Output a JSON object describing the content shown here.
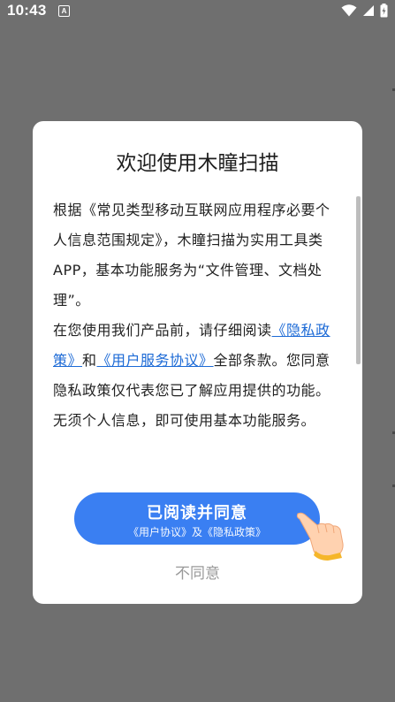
{
  "status_bar": {
    "time": "10:43",
    "notification_icon": "A"
  },
  "dialog": {
    "title": "欢迎使用木瞳扫描",
    "body": {
      "p1": "根据《常见类型移动互联网应用程序必要个人信息范围规定》，木瞳扫描为实用工具类APP，基本功能服务为“文件管理、文档处理”。",
      "p2_prefix": "在您使用我们产品前，请仔细阅读",
      "privacy_link": "《隐私政策》",
      "and": "和",
      "terms_link": "《用户服务协议》",
      "p2_suffix": "全部条款。您同意隐私政策仅代表您已了解应用提供的功能。无须个人信息，即可使用基本功能服务。"
    },
    "agree_button": {
      "label": "已阅读并同意",
      "sub_label": "《用户协议》及《隐私政策》"
    },
    "disagree_label": "不同意"
  },
  "icons": {
    "wifi": "wifi-icon",
    "signal": "signal-icon",
    "battery": "battery-icon",
    "hand": "pointing-hand-icon"
  },
  "colors": {
    "overlay": "#6f6f6f",
    "primary": "#3a7ff2",
    "link": "#1c6ad6",
    "muted": "#9a9a9a"
  }
}
